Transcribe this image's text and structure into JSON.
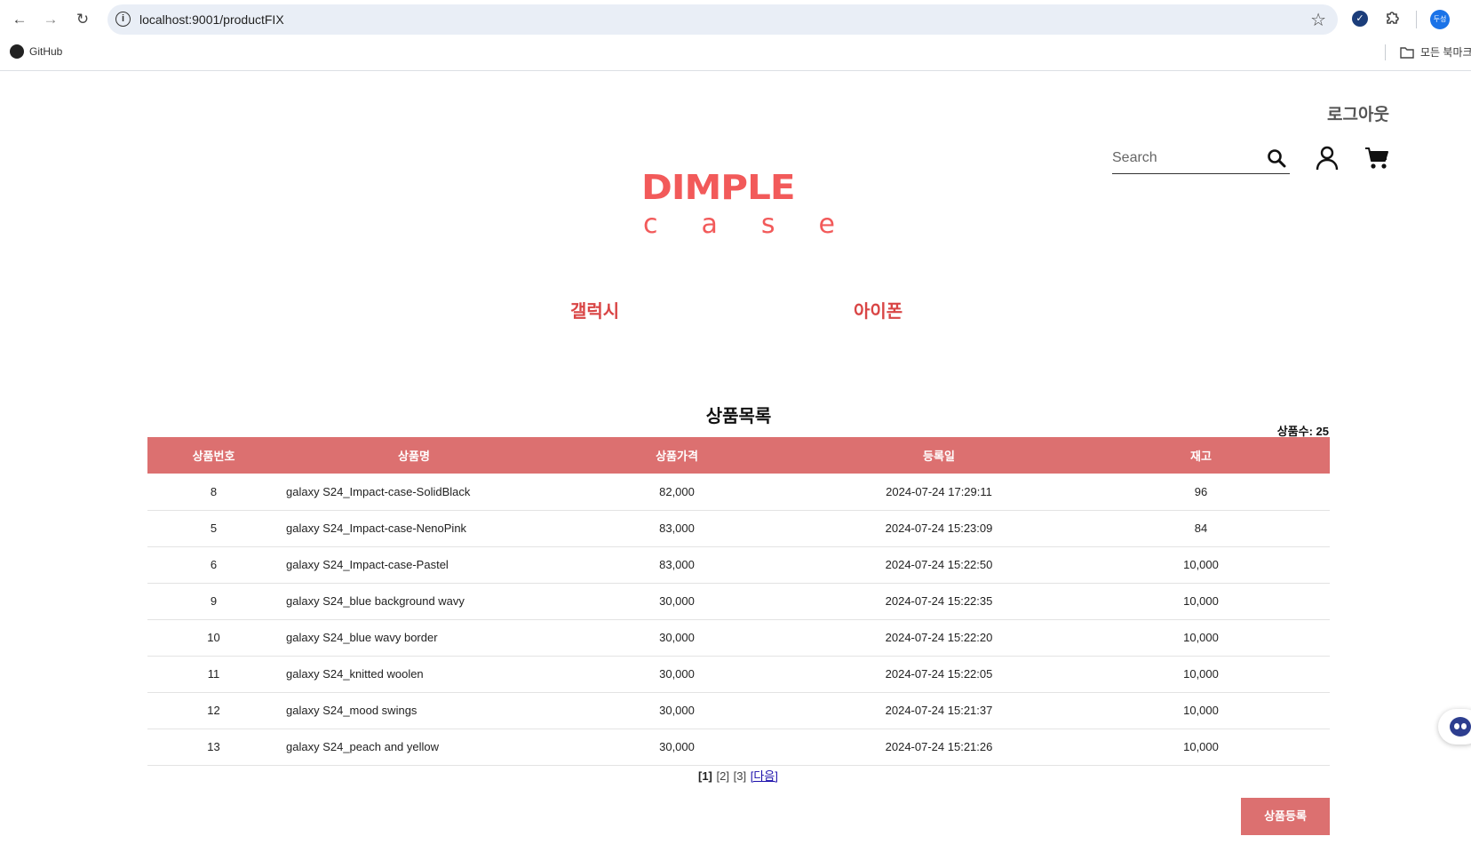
{
  "browser": {
    "url": "localhost:9001/productFIX",
    "profile_initial": "두성",
    "bookmarks": {
      "github": "GitHub",
      "all_bookmarks": "모든 북마크"
    }
  },
  "header": {
    "logout": "로그아웃",
    "search_placeholder": "Search",
    "logo_top": "DIMPLE",
    "logo_bottom": [
      "c",
      "a",
      "s",
      "e"
    ]
  },
  "categories": [
    "갤럭시",
    "아이폰"
  ],
  "product_list": {
    "title": "상품목록",
    "count_label": "상품수: ",
    "count": "25",
    "columns": [
      "상품번호",
      "상품명",
      "상품가격",
      "등록일",
      "재고"
    ],
    "rows": [
      {
        "no": "8",
        "name": "galaxy S24_Impact-case-SolidBlack",
        "price": "82,000",
        "date": "2024-07-24 17:29:11",
        "stock": "96"
      },
      {
        "no": "5",
        "name": "galaxy S24_Impact-case-NenoPink",
        "price": "83,000",
        "date": "2024-07-24 15:23:09",
        "stock": "84"
      },
      {
        "no": "6",
        "name": "galaxy S24_Impact-case-Pastel",
        "price": "83,000",
        "date": "2024-07-24 15:22:50",
        "stock": "10,000"
      },
      {
        "no": "9",
        "name": "galaxy S24_blue background wavy",
        "price": "30,000",
        "date": "2024-07-24 15:22:35",
        "stock": "10,000"
      },
      {
        "no": "10",
        "name": "galaxy S24_blue wavy border",
        "price": "30,000",
        "date": "2024-07-24 15:22:20",
        "stock": "10,000"
      },
      {
        "no": "11",
        "name": "galaxy S24_knitted woolen",
        "price": "30,000",
        "date": "2024-07-24 15:22:05",
        "stock": "10,000"
      },
      {
        "no": "12",
        "name": "galaxy S24_mood swings",
        "price": "30,000",
        "date": "2024-07-24 15:21:37",
        "stock": "10,000"
      },
      {
        "no": "13",
        "name": "galaxy S24_peach and yellow",
        "price": "30,000",
        "date": "2024-07-24 15:21:26",
        "stock": "10,000"
      }
    ]
  },
  "pagination": {
    "pages": [
      "[1]",
      "[2]",
      "[3]"
    ],
    "current": "[1]",
    "next": "[다음]"
  },
  "register_button": "상품등록",
  "colors": {
    "accent": "#dc7070",
    "logo": "#f25a5a",
    "category": "#d94545"
  }
}
